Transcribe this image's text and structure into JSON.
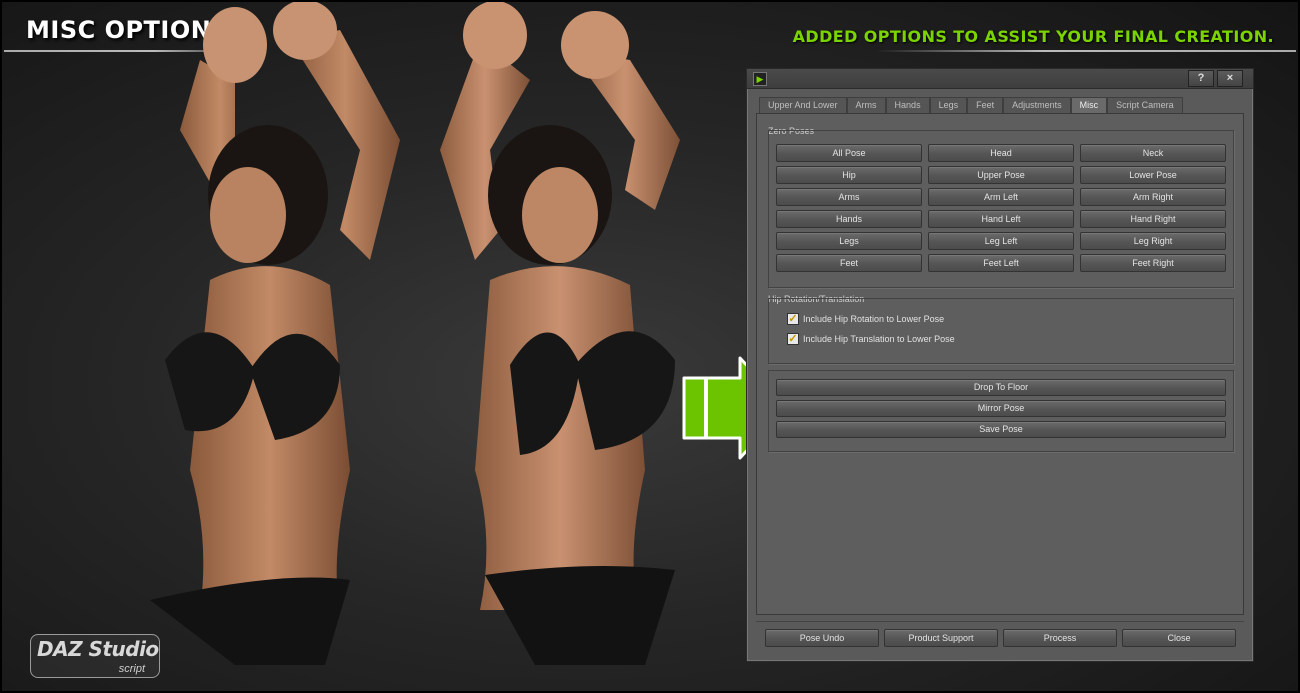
{
  "header": {
    "title": "MISC OPTIONS",
    "tagline": "ADDED OPTIONS TO ASSIST YOUR FINAL CREATION."
  },
  "logo": {
    "brand": "DAZ Studio",
    "sub": "script"
  },
  "colors": {
    "accent_green": "#7bd400",
    "dialog_bg": "#5a5a5a",
    "checkbox_check": "#c89400"
  },
  "dialog": {
    "app_icon": "daz-app-icon",
    "help_label": "?",
    "close_label": "×",
    "tabs": [
      {
        "label": "Upper And Lower"
      },
      {
        "label": "Arms"
      },
      {
        "label": "Hands"
      },
      {
        "label": "Legs"
      },
      {
        "label": "Feet"
      },
      {
        "label": "Adjustments"
      },
      {
        "label": "Misc",
        "active": true
      },
      {
        "label": "Script Camera"
      }
    ],
    "zero_poses": {
      "label": "Zero Poses",
      "buttons": [
        [
          "All Pose",
          "Head",
          "Neck"
        ],
        [
          "Hip",
          "Upper Pose",
          "Lower Pose"
        ],
        [
          "Arms",
          "Arm Left",
          "Arm Right"
        ],
        [
          "Hands",
          "Hand Left",
          "Hand Right"
        ],
        [
          "Legs",
          "Leg Left",
          "Leg Right"
        ],
        [
          "Feet",
          "Feet Left",
          "Feet Right"
        ]
      ]
    },
    "hip_group": {
      "label": "Hip Rotation/Translation",
      "options": [
        {
          "label": "Include Hip Rotation to Lower Pose",
          "checked": true
        },
        {
          "label": "Include Hip Translation to Lower Pose",
          "checked": true
        }
      ]
    },
    "actions": [
      "Drop To Floor",
      "Mirror Pose",
      "Save Pose"
    ],
    "footer_buttons": [
      "Pose Undo",
      "Product Support",
      "Process",
      "Close"
    ]
  }
}
